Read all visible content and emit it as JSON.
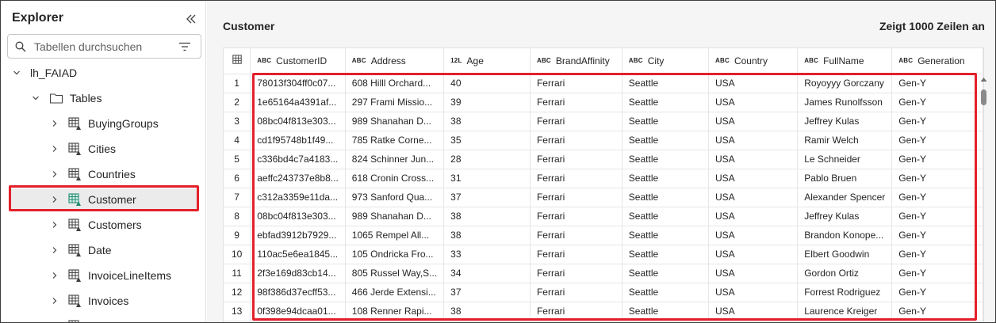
{
  "explorer": {
    "title": "Explorer",
    "search_placeholder": "Tabellen durchsuchen",
    "lakehouse": "lh_FAIAD",
    "tables_folder": "Tables",
    "tables": [
      {
        "label": "BuyingGroups"
      },
      {
        "label": "Cities"
      },
      {
        "label": "Countries"
      },
      {
        "label": "Customer"
      },
      {
        "label": "Customers"
      },
      {
        "label": "Date"
      },
      {
        "label": "InvoiceLineItems"
      },
      {
        "label": "Invoices"
      }
    ],
    "selected_table": "Customer",
    "colors": {
      "accent": "#e3202a",
      "selected_icon": "#1f8a70"
    }
  },
  "main": {
    "title": "Customer",
    "row_count": "Zeigt 1000 Zeilen an",
    "columns": [
      {
        "type": "ABC",
        "name": "CustomerID"
      },
      {
        "type": "ABC",
        "name": "Address"
      },
      {
        "type": "12L",
        "name": "Age"
      },
      {
        "type": "ABC",
        "name": "BrandAffinity"
      },
      {
        "type": "ABC",
        "name": "City"
      },
      {
        "type": "ABC",
        "name": "Country"
      },
      {
        "type": "ABC",
        "name": "FullName"
      },
      {
        "type": "ABC",
        "name": "Generation"
      }
    ],
    "rows": [
      {
        "n": "1",
        "cells": [
          "78013f304ff0c07...",
          "608 Hilll Orchard...",
          "40",
          "Ferrari",
          "Seattle",
          "USA",
          "Royoyyy Gorczany",
          "Gen-Y"
        ]
      },
      {
        "n": "2",
        "cells": [
          "1e65164a4391af...",
          "297 Frami Missio...",
          "39",
          "Ferrari",
          "Seattle",
          "USA",
          "James Runolfsson",
          "Gen-Y"
        ]
      },
      {
        "n": "3",
        "cells": [
          "08bc04f813e303...",
          "989 Shanahan D...",
          "38",
          "Ferrari",
          "Seattle",
          "USA",
          "Jeffrey Kulas",
          "Gen-Y"
        ]
      },
      {
        "n": "4",
        "cells": [
          "cd1f95748b1f49...",
          "785 Ratke Corne...",
          "35",
          "Ferrari",
          "Seattle",
          "USA",
          "Ramir Welch",
          "Gen-Y"
        ]
      },
      {
        "n": "5",
        "cells": [
          "c336bd4c7a4183...",
          "824 Schinner Jun...",
          "28",
          "Ferrari",
          "Seattle",
          "USA",
          "Le Schneider",
          "Gen-Y"
        ]
      },
      {
        "n": "6",
        "cells": [
          "aeffc243737e8b8...",
          "618 Cronin Cross...",
          "31",
          "Ferrari",
          "Seattle",
          "USA",
          "Pablo Bruen",
          "Gen-Y"
        ]
      },
      {
        "n": "7",
        "cells": [
          "c312a3359e11da...",
          "973 Sanford Qua...",
          "37",
          "Ferrari",
          "Seattle",
          "USA",
          "Alexander Spencer",
          "Gen-Y"
        ]
      },
      {
        "n": "8",
        "cells": [
          "08bc04f813e303...",
          "989 Shanahan D...",
          "38",
          "Ferrari",
          "Seattle",
          "USA",
          "Jeffrey Kulas",
          "Gen-Y"
        ]
      },
      {
        "n": "9",
        "cells": [
          "ebfad3912b7929...",
          "1065 Rempel All...",
          "38",
          "Ferrari",
          "Seattle",
          "USA",
          "Brandon Konope...",
          "Gen-Y"
        ]
      },
      {
        "n": "10",
        "cells": [
          "110ac5e6ea1845...",
          "105 Ondricka Fro...",
          "33",
          "Ferrari",
          "Seattle",
          "USA",
          "Elbert Goodwin",
          "Gen-Y"
        ]
      },
      {
        "n": "11",
        "cells": [
          "2f3e169d83cb14...",
          "805 Russel Way,S...",
          "34",
          "Ferrari",
          "Seattle",
          "USA",
          "Gordon Ortiz",
          "Gen-Y"
        ]
      },
      {
        "n": "12",
        "cells": [
          "98f386d37ecff53...",
          "466 Jerde Extensi...",
          "37",
          "Ferrari",
          "Seattle",
          "USA",
          "Forrest Rodriguez",
          "Gen-Y"
        ]
      },
      {
        "n": "13",
        "cells": [
          "0f398e94dcaa01...",
          "108 Renner Rapi...",
          "38",
          "Ferrari",
          "Seattle",
          "USA",
          "Laurence Kreiger",
          "Gen-Y"
        ]
      }
    ]
  }
}
